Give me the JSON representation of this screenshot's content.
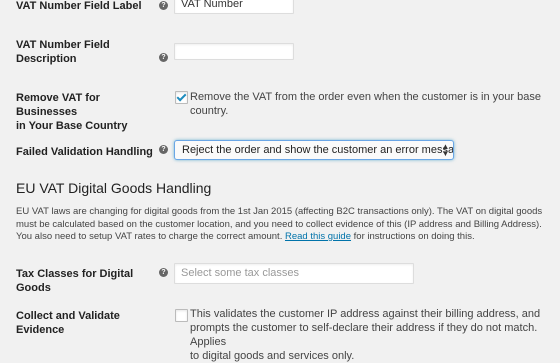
{
  "fields": {
    "vat_label": {
      "label": "VAT Number Field Label",
      "value": "VAT Number"
    },
    "vat_description": {
      "label_line1": "VAT Number Field",
      "label_line2": "Description",
      "value": ""
    },
    "remove_vat": {
      "label_line1": "Remove VAT for Businesses",
      "label_line2": "in Your Base Country",
      "checked": true,
      "text_line1": "Remove the VAT from the order even when the customer is in your base",
      "text_line2": "country."
    },
    "failed_validation": {
      "label": "Failed Validation Handling",
      "selected": "Reject the order and show the customer an error message"
    },
    "tax_classes": {
      "label": "Tax Classes for Digital Goods",
      "placeholder": "Select some tax classes"
    },
    "collect_evidence": {
      "label": "Collect and Validate Evidence",
      "checked": false,
      "text_line1": "This validates the customer IP address against their billing address, and",
      "text_line2": "prompts the customer to self-declare their address if they do not match. Applies",
      "text_line3": "to digital goods and services only."
    }
  },
  "section": {
    "title": "EU VAT Digital Goods Handling",
    "desc_line1": "EU VAT laws are changing for digital goods from the 1st Jan 2015 (affecting B2C transactions only). The VAT on digital goods",
    "desc_line2": "must be calculated based on the customer location, and you need to collect evidence of this (IP address and Billing Address).",
    "desc_line3_before": "You also need to setup VAT rates to charge the correct amount. ",
    "desc_link": "Read this guide",
    "desc_line3_after": " for instructions on doing this."
  },
  "help_glyph": "?",
  "icons": {
    "help": "help-icon",
    "checkbox_check": "checkmark-icon",
    "select_arrows": "updown-arrows-icon"
  },
  "colors": {
    "background": "#f1f1f1",
    "link": "#0073aa",
    "checkmark": "#1e8cbe",
    "focus_border": "#6aa6e6"
  }
}
